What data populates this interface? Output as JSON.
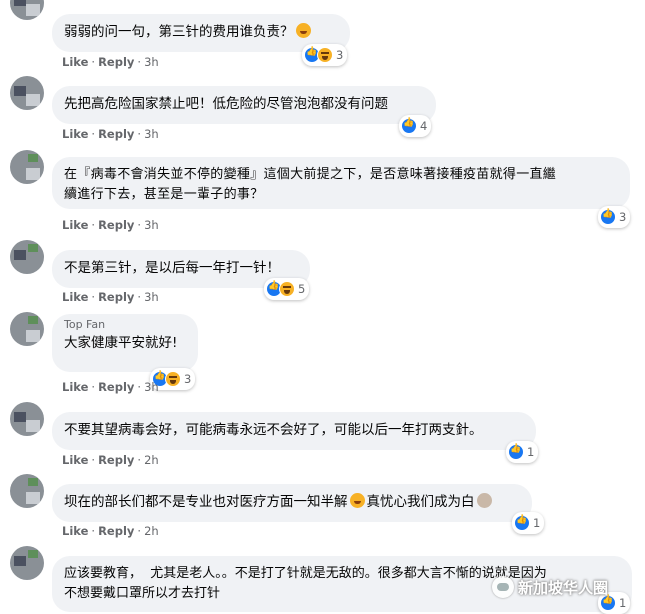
{
  "actions": {
    "like_label": "Like",
    "reply_label": "Reply",
    "separator": "·"
  },
  "comments": [
    {
      "text": "弱弱的问一句，第三针的费用谁负责？",
      "time": "3h",
      "reactions": [
        "like",
        "haha"
      ],
      "reaction_count": "3"
    },
    {
      "text": "先把高危险国家禁止吧！低危险的尽管泡泡都没有问题",
      "time": "3h",
      "reactions": [
        "like"
      ],
      "reaction_count": "4"
    },
    {
      "text": "在『病毒不會消失並不停的變種』這個大前提之下，是否意味著接種疫苗就得一直繼\n續進行下去，甚至是一輩子的事？",
      "time": "3h",
      "reactions": [
        "like"
      ],
      "reaction_count": "3"
    },
    {
      "text": "不是第三针，是以后每一年打一针！",
      "time": "3h",
      "reactions": [
        "like",
        "haha"
      ],
      "reaction_count": "5"
    },
    {
      "top_fan": "Top Fan",
      "text": "大家健康平安就好!",
      "time": "3h",
      "reactions": [
        "like",
        "haha"
      ],
      "reaction_count": "3"
    },
    {
      "text": "不要其望病毒会好，可能病毒永远不会好了，可能以后一年打两支針。",
      "time": "2h",
      "reactions": [
        "like"
      ],
      "reaction_count": "1"
    },
    {
      "text_before": "坝在的部长们都不是专业也对医疗方面一知半解",
      "text_after": "真忧心我们成为白",
      "time": "2h",
      "reactions": [
        "like"
      ],
      "reaction_count": "1"
    },
    {
      "text": "应该要教育，  尤其是老人。。不是打了针就是无敌的。很多都大言不惭的说就是因为\n不想要戴口罩所以才去打针",
      "reaction_count": "1"
    }
  ],
  "watermark": {
    "text": "新加坡华人圈"
  }
}
